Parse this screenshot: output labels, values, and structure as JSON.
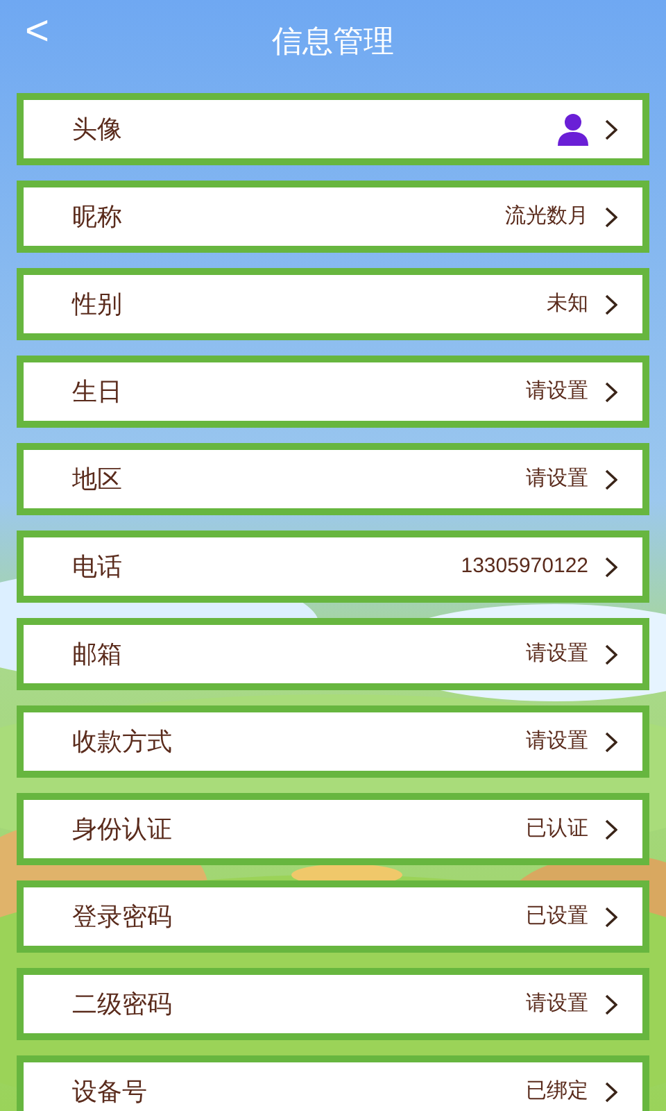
{
  "header": {
    "back": "<",
    "title": "信息管理"
  },
  "rows": [
    {
      "label": "头像",
      "kind": "avatar"
    },
    {
      "label": "昵称",
      "kind": "text",
      "value": "流光数月"
    },
    {
      "label": "性别",
      "kind": "text",
      "value": "未知"
    },
    {
      "label": "生日",
      "kind": "text",
      "value": "请设置"
    },
    {
      "label": "地区",
      "kind": "text",
      "value": "请设置"
    },
    {
      "label": "电话",
      "kind": "text",
      "value": "13305970122"
    },
    {
      "label": "邮箱",
      "kind": "text",
      "value": "请设置"
    },
    {
      "label": "收款方式",
      "kind": "text",
      "value": "请设置"
    },
    {
      "label": "身份认证",
      "kind": "text",
      "value": "已认证"
    },
    {
      "label": "登录密码",
      "kind": "text",
      "value": "已设置"
    },
    {
      "label": "二级密码",
      "kind": "text",
      "value": "请设置"
    },
    {
      "label": "设备号",
      "kind": "text",
      "value": "已绑定"
    }
  ]
}
